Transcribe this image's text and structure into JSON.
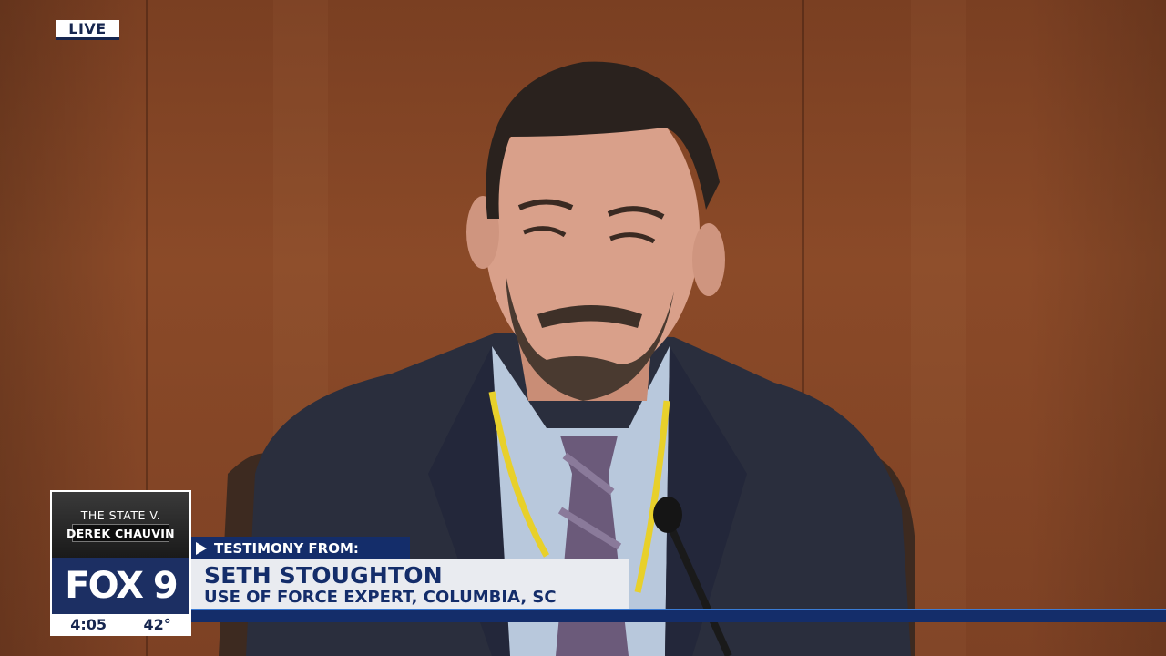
{
  "live_label": "LIVE",
  "bug": {
    "show_line1": "THE STATE V.",
    "show_line2": "DEREK CHAUVIN",
    "station": "FOX 9",
    "time": "4:05",
    "temperature": "42°"
  },
  "lower_third": {
    "label": "TESTIMONY FROM:",
    "name": "SETH STOUGHTON",
    "title": "USE OF FORCE EXPERT, COLUMBIA, SC"
  },
  "colors": {
    "navy": "#142d6a",
    "wood": "#8b4a28",
    "light_panel": "#e9ebf0"
  }
}
